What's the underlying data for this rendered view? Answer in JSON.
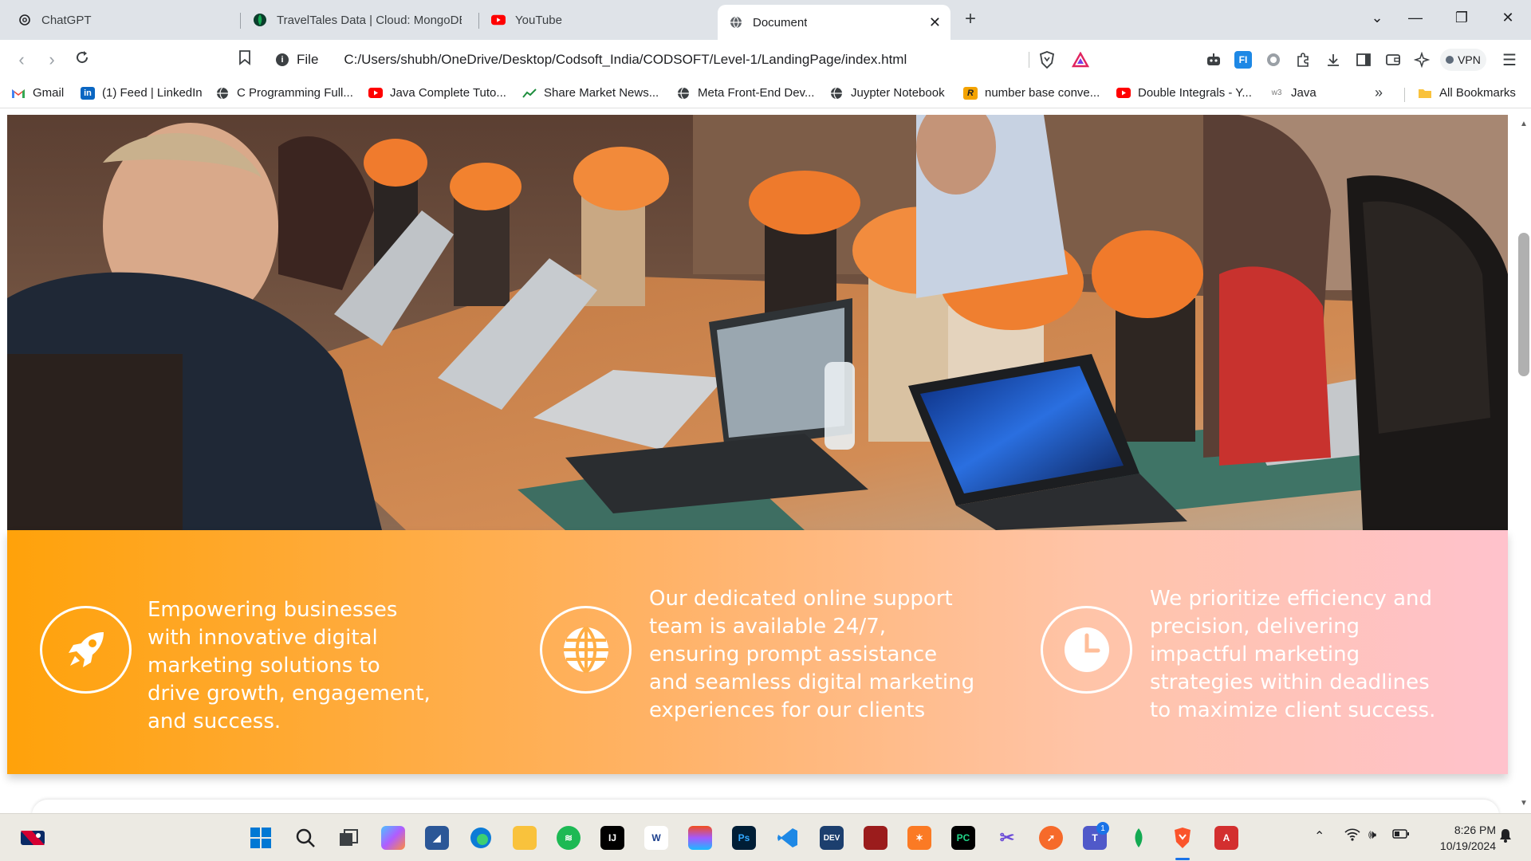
{
  "browser": {
    "tabs": [
      {
        "title": "ChatGPT",
        "icon": "chatgpt-icon",
        "active": false
      },
      {
        "title": "TravelTales Data | Cloud: MongoDB",
        "icon": "mongodb-leaf-icon",
        "active": false
      },
      {
        "title": "YouTube",
        "icon": "youtube-icon",
        "active": false
      },
      {
        "title": "Document",
        "icon": "globe-icon",
        "active": true
      }
    ],
    "address": {
      "scheme_label": "File",
      "url": "C:/Users/shubh/OneDrive/Desktop/Codsoft_India/CODSOFT/Level-1/LandingPage/index.html"
    },
    "vpn_label": "VPN",
    "bookmarks": [
      {
        "label": "Gmail",
        "icon": "gmail-icon"
      },
      {
        "label": "(1) Feed | LinkedIn",
        "icon": "linkedin-icon"
      },
      {
        "label": "C Programming Full...",
        "icon": "globe-icon"
      },
      {
        "label": "Java Complete Tuto...",
        "icon": "youtube-icon"
      },
      {
        "label": "Share Market News...",
        "icon": "chart-icon"
      },
      {
        "label": "Meta Front-End Dev...",
        "icon": "globe-icon"
      },
      {
        "label": "Juypter Notebook",
        "icon": "globe-icon"
      },
      {
        "label": "number base conve...",
        "icon": "r-icon"
      },
      {
        "label": "Double Integrals - Y...",
        "icon": "youtube-icon"
      },
      {
        "label": "Java",
        "icon": "w3schools-icon"
      }
    ],
    "all_bookmarks_label": "All Bookmarks"
  },
  "page": {
    "features": [
      {
        "icon": "rocket-icon",
        "text": "Empowering businesses with innovative digital marketing solutions to drive growth, engagement, and success."
      },
      {
        "icon": "globe-icon",
        "text": "Our dedicated online support team is available 24/7, ensuring prompt assistance and seamless digital marketing experiences for our clients"
      },
      {
        "icon": "clock-icon",
        "text": "We prioritize efficiency and precision, delivering impactful marketing strategies within deadlines to maximize client success."
      }
    ],
    "colors": {
      "gradient_start": "#ffa20a",
      "gradient_end": "#ffc2cc"
    }
  },
  "taskbar": {
    "time": "8:26 PM",
    "date": "10/19/2024",
    "notification_badge": "1"
  }
}
